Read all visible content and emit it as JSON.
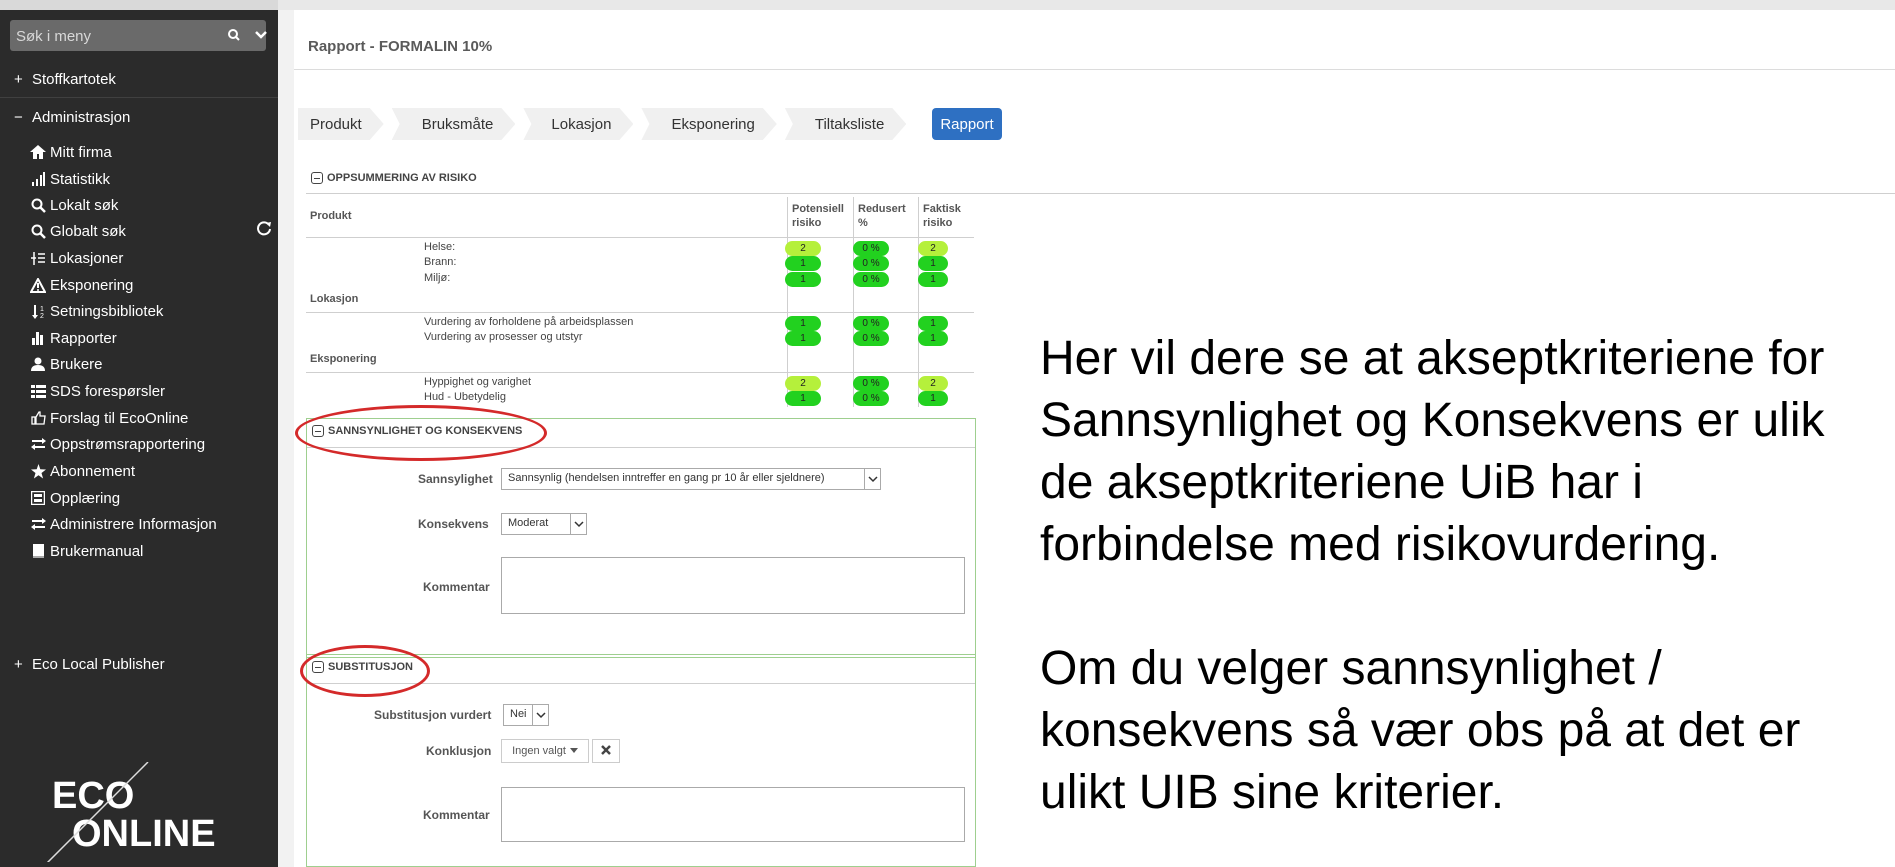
{
  "sidebar": {
    "search_placeholder": "Søk i meny",
    "sections": [
      {
        "sign": "+",
        "label": "Stoffkartotek"
      },
      {
        "sign": "−",
        "label": "Administrasjon"
      },
      {
        "sign": "+",
        "label": "Eco Local Publisher"
      }
    ],
    "items": [
      {
        "label": "Mitt firma",
        "icon": "home-icon"
      },
      {
        "label": "Statistikk",
        "icon": "signal-bars-icon"
      },
      {
        "label": "Lokalt søk",
        "icon": "search-icon"
      },
      {
        "label": "Globalt søk",
        "icon": "search-icon"
      },
      {
        "label": "Lokasjoner",
        "icon": "tree-list-icon"
      },
      {
        "label": "Eksponering",
        "icon": "warning-icon"
      },
      {
        "label": "Setningsbibliotek",
        "icon": "sort-icon"
      },
      {
        "label": "Rapporter",
        "icon": "bar-chart-icon"
      },
      {
        "label": "Brukere",
        "icon": "user-icon"
      },
      {
        "label": "SDS forespørsler",
        "icon": "list-icon"
      },
      {
        "label": "Forslag til EcoOnline",
        "icon": "thumbs-up-icon"
      },
      {
        "label": "Oppstrømsrapportering",
        "icon": "exchange-icon"
      },
      {
        "label": "Abonnement",
        "icon": "star-icon"
      },
      {
        "label": "Opplæring",
        "icon": "film-icon"
      },
      {
        "label": "Administrere Informasjon",
        "icon": "exchange-icon"
      },
      {
        "label": "Brukermanual",
        "icon": "book-icon"
      }
    ],
    "logo_text_top": "ECO",
    "logo_text_bottom": "ONLINE"
  },
  "page": {
    "title": "Rapport - FORMALIN 10%",
    "steps": [
      "Produkt",
      "Bruksmåte",
      "Lokasjon",
      "Eksponering",
      "Tiltaksliste",
      "Rapport"
    ],
    "active_step": "Rapport"
  },
  "risk_summary": {
    "heading": "OPPSUMMERING AV RISIKO",
    "col_product": "Produkt",
    "col_potential": "Potensiell risiko",
    "col_reduced": "Redusert %",
    "col_actual": "Faktisk risiko",
    "groups": [
      {
        "name": "",
        "rows": [
          {
            "label": "Helse:",
            "pot": "2",
            "red": "0 %",
            "act": "2",
            "pot_light": true,
            "act_light": true
          },
          {
            "label": "Brann:",
            "pot": "1",
            "red": "0 %",
            "act": "1",
            "pot_light": false,
            "act_light": false
          },
          {
            "label": "Miljø:",
            "pot": "1",
            "red": "0 %",
            "act": "1",
            "pot_light": false,
            "act_light": false
          }
        ]
      },
      {
        "name": "Lokasjon",
        "rows": [
          {
            "label": "Vurdering av forholdene på arbeidsplassen",
            "pot": "1",
            "red": "0 %",
            "act": "1",
            "pot_light": false,
            "act_light": false
          },
          {
            "label": "Vurdering av prosesser og utstyr",
            "pot": "1",
            "red": "0 %",
            "act": "1",
            "pot_light": false,
            "act_light": false
          }
        ]
      },
      {
        "name": "Eksponering",
        "rows": [
          {
            "label": "Hyppighet og varighet",
            "pot": "2",
            "red": "0 %",
            "act": "2",
            "pot_light": true,
            "act_light": true
          },
          {
            "label": "Hud - Ubetydelig",
            "pot": "1",
            "red": "0 %",
            "act": "1",
            "pot_light": false,
            "act_light": false
          }
        ]
      }
    ]
  },
  "likelihood": {
    "heading": "SANNSYNLIGHET OG KONSEKVENS",
    "sannsynlighet_label": "Sannsylighet",
    "sannsynlighet_value": "Sannsynlig (hendelsen inntreffer en gang pr 10 år eller sjeldnere)",
    "konsekvens_label": "Konsekvens",
    "konsekvens_value": "Moderat",
    "kommentar_label": "Kommentar"
  },
  "substitution": {
    "heading": "SUBSTITUSJON",
    "vurdert_label": "Substitusjon vurdert",
    "vurdert_value": "Nei",
    "konklusjon_label": "Konklusjon",
    "konklusjon_value": "Ingen valgt",
    "kommentar_label": "Kommentar"
  },
  "overlay": {
    "para1": "Her vil dere se at akseptkriteriene for Sannsynlighet og Konsekvens er ulik de akseptkriteriene UiB har i forbindelse med risikovurdering.",
    "para2": "Om du velger sannsynlighet / konsekvens så vær obs på at det er ulikt UIB sine kriterier."
  },
  "colors": {
    "sidebar_bg": "#2b2b2b",
    "active_step": "#2e70c2",
    "risk_green": "#22d11f",
    "risk_light_green": "#b5f03b",
    "annotation_red": "#d42a2a"
  }
}
